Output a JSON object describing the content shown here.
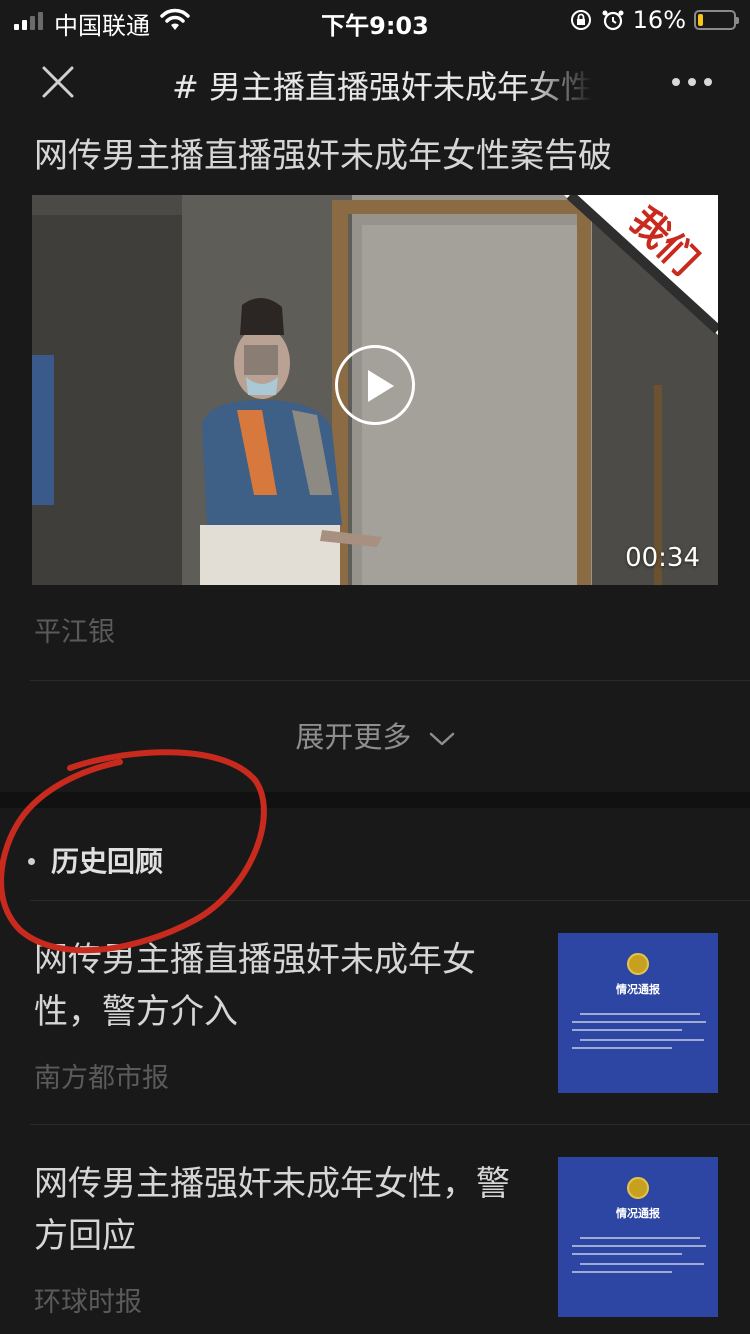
{
  "status_bar": {
    "carrier": "中国联通",
    "time": "下午9:03",
    "battery_percent": "16%",
    "battery_level": 0.16,
    "battery_color": "#f5c518"
  },
  "nav": {
    "title": "# 男主播直播强奸未成年女性",
    "close_icon": "close-icon",
    "more_icon": "more-dots-icon"
  },
  "article": {
    "headline": "网传男主播直播强奸未成年女性案告破",
    "video": {
      "duration": "00:34",
      "watermark": "我们",
      "play_icon": "play-icon"
    },
    "source": "平江银",
    "expand_label": "展开更多"
  },
  "history": {
    "section_title": "历史回顾",
    "items": [
      {
        "title": "网传男主播直播强奸未成年女性，警方介入",
        "source": "南方都市报",
        "thumb_title": "情况通报"
      },
      {
        "title": "网传男主播强奸未成年女性，警方回应",
        "source": "环球时报",
        "thumb_title": "情况通报"
      }
    ]
  },
  "annotation": {
    "color": "#c92a1e"
  }
}
